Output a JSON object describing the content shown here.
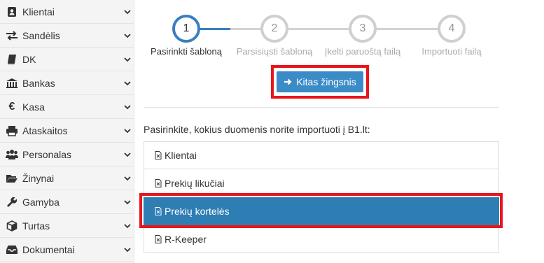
{
  "sidebar": {
    "items": [
      {
        "label": "Klientai",
        "icon": "address-book-icon"
      },
      {
        "label": "Sandėlis",
        "icon": "exchange-arrows-icon"
      },
      {
        "label": "DK",
        "icon": "book-icon"
      },
      {
        "label": "Bankas",
        "icon": "bank-icon"
      },
      {
        "label": "Kasa",
        "icon": "euro-icon"
      },
      {
        "label": "Ataskaitos",
        "icon": "printer-icon"
      },
      {
        "label": "Personalas",
        "icon": "users-icon"
      },
      {
        "label": "Žinynai",
        "icon": "folder-open-icon"
      },
      {
        "label": "Gamyba",
        "icon": "wrench-icon"
      },
      {
        "label": "Turtas",
        "icon": "cube-icon"
      },
      {
        "label": "Dokumentai",
        "icon": "inbox-icon"
      }
    ]
  },
  "stepper": {
    "steps": [
      {
        "number": "1",
        "label": "Pasirinkti šabloną",
        "state": "active"
      },
      {
        "number": "2",
        "label": "Parsisiųsti šabloną",
        "state": "inactive"
      },
      {
        "number": "3",
        "label": "Įkelti paruoštą failą",
        "state": "inactive"
      },
      {
        "number": "4",
        "label": "Importuoti failą",
        "state": "inactive"
      }
    ]
  },
  "next_button": {
    "label": "Kitas žingsnis",
    "icon": "arrow-right-icon"
  },
  "prompt": "Pasirinkite, kokius duomenis norite importuoti į B1.lt:",
  "import_types": [
    {
      "label": "Klientai",
      "selected": false
    },
    {
      "label": "Prekių likučiai",
      "selected": false
    },
    {
      "label": "Prekių kortelės",
      "selected": true
    },
    {
      "label": "R-Keeper",
      "selected": false
    }
  ],
  "colors": {
    "accent": "#3b8bc7",
    "selected": "#2e7db3",
    "highlight": "#e8151c",
    "step_active": "#3a7fbf",
    "step_inactive": "#cfcfcf"
  }
}
